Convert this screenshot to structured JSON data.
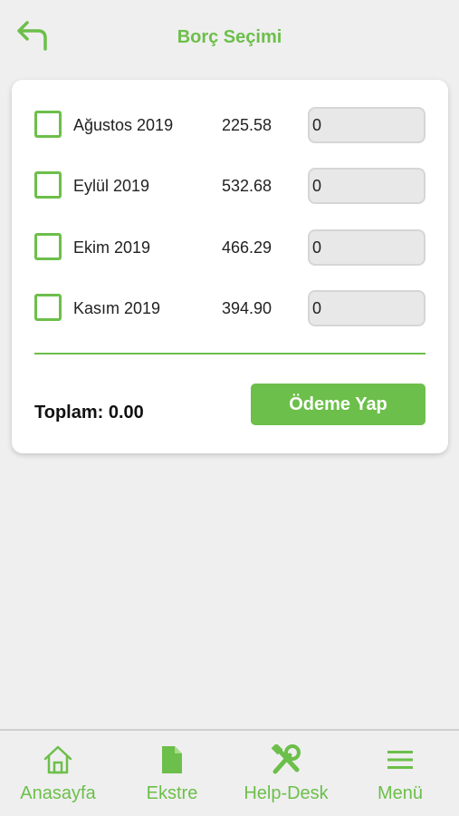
{
  "header": {
    "title": "Borç Seçimi",
    "back_icon": "back-arrow-icon"
  },
  "debts": [
    {
      "month": "Ağustos 2019",
      "amount": "225.58",
      "payment": "0",
      "checked": false
    },
    {
      "month": "Eylül 2019",
      "amount": "532.68",
      "payment": "0",
      "checked": false
    },
    {
      "month": "Ekim 2019",
      "amount": "466.29",
      "payment": "0",
      "checked": false
    },
    {
      "month": "Kasım 2019",
      "amount": "394.90",
      "payment": "0",
      "checked": false
    }
  ],
  "summary": {
    "total_label": "Toplam: 0.00",
    "pay_button_label": "Ödeme Yap"
  },
  "bottom_nav": [
    {
      "label": "Anasayfa",
      "icon": "home-icon"
    },
    {
      "label": "Ekstre",
      "icon": "document-icon"
    },
    {
      "label": "Help-Desk",
      "icon": "tools-icon"
    },
    {
      "label": "Menü",
      "icon": "menu-icon"
    }
  ],
  "colors": {
    "accent": "#6cbf4a",
    "background": "#efefef",
    "card": "#ffffff",
    "input_bg": "#e8e8e8"
  }
}
